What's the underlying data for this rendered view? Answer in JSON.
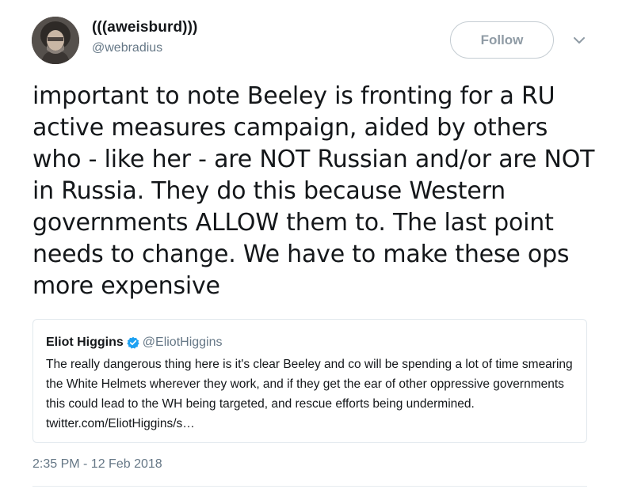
{
  "author": {
    "display_name": "(((aweisburd)))",
    "handle": "@webradius"
  },
  "follow_button": {
    "label": "Follow"
  },
  "more_menu": {
    "icon": "chevron-down-icon"
  },
  "tweet": {
    "text": "important to note Beeley is fronting for a RU active measures campaign, aided by others who - like her - are NOT Russian and/or are NOT in Russia. They do this because Western governments ALLOW them to. The last point needs to change. We have to make these ops more expensive",
    "timestamp": "2:35 PM - 12 Feb 2018"
  },
  "quoted_tweet": {
    "display_name": "Eliot Higgins",
    "verified_icon": "verified-badge-icon",
    "handle": "@EliotHiggins",
    "text": "The really dangerous thing here is it's clear Beeley and co will be spending a lot of time smearing the White Helmets wherever they work, and if they get the ear of other oppressive governments this could lead to the WH being targeted, and rescue efforts being undermined. twitter.com/EliotHiggins/s…"
  },
  "colors": {
    "text_primary": "#14171a",
    "text_secondary": "#657786",
    "verified_blue": "#1da1f2",
    "border": "#e1e8ed"
  }
}
